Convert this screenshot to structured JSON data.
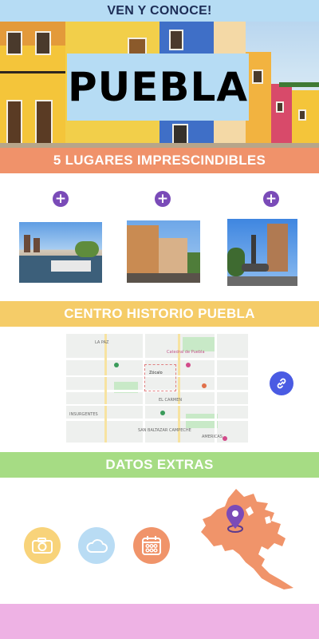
{
  "header": {
    "title": "VEN Y CONOCE!"
  },
  "hero": {
    "title": "PUEBLA"
  },
  "places": {
    "title": "5 LUGARES IMPRESCINDIBLES",
    "items": [
      {
        "icon": "plus-icon"
      },
      {
        "icon": "plus-icon"
      },
      {
        "icon": "plus-icon"
      }
    ]
  },
  "centro": {
    "title": "CENTRO HISTORIO PUEBLA",
    "map_labels": {
      "la_paz": "LA PAZ",
      "catedral": "Catedral de Puebla",
      "zocalo": "Zócalo",
      "centro": "EL CARMEN",
      "insurgentes": "INSURGENTES",
      "san_baltazar": "SAN BALTAZAR CAMPECHE",
      "americas": "AMERICAS"
    },
    "link_icon": "link-icon"
  },
  "datos": {
    "title": "DATOS EXTRAS",
    "icons": [
      "camera-icon",
      "cloud-icon",
      "calendar-icon",
      "map-pin-icon"
    ]
  },
  "colors": {
    "header_band": "#b6dcf4",
    "places_band": "#f0926a",
    "centro_band": "#f5cc68",
    "datos_band": "#a6dc84",
    "footer_band": "#eeb2e4",
    "plus_button": "#7a4bb8",
    "link_button": "#4a5be3",
    "map_shape": "#f0946a"
  }
}
